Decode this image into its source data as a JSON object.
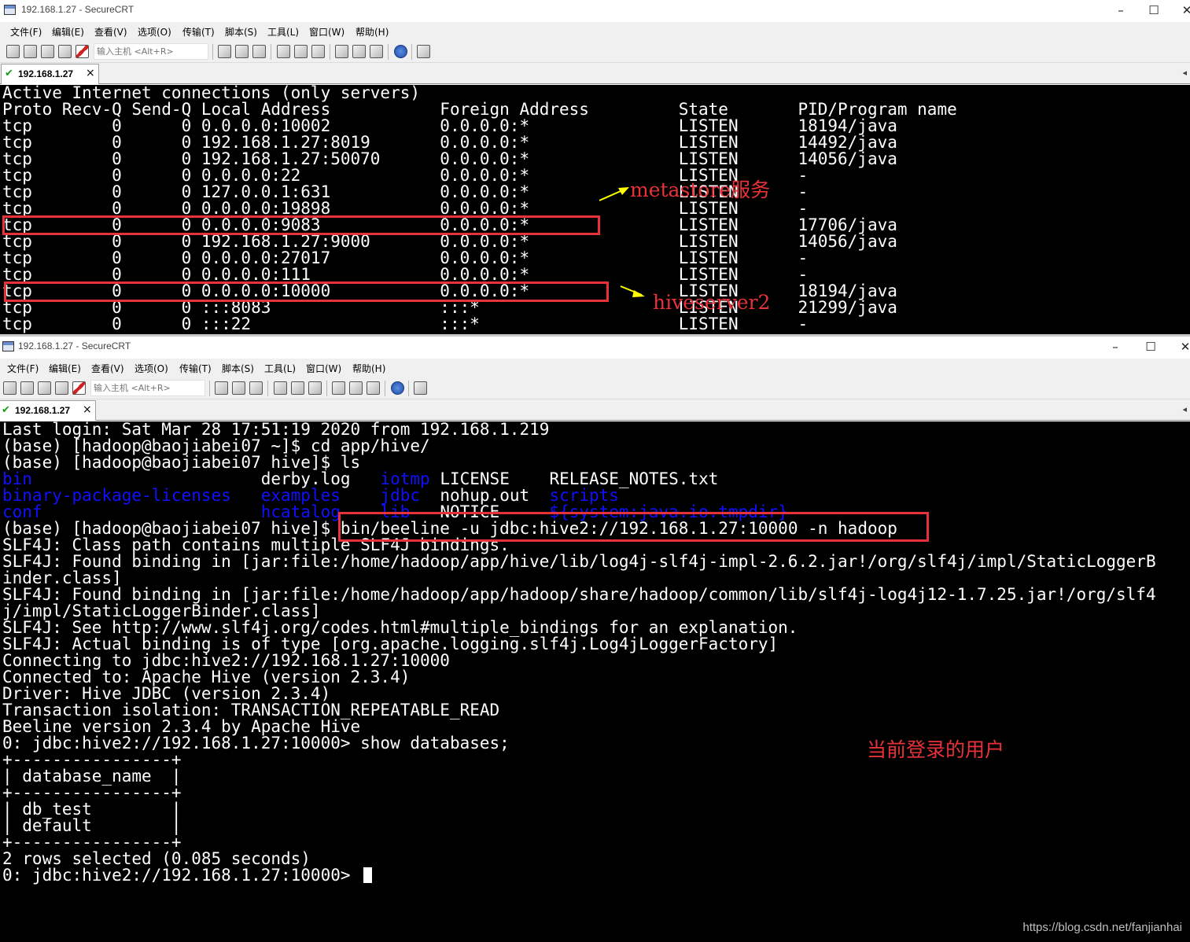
{
  "window1": {
    "title": "192.168.1.27 - SecureCRT",
    "menu": [
      "文件(F)",
      "编辑(E)",
      "查看(V)",
      "选项(O)",
      "传输(T)",
      "脚本(S)",
      "工具(L)",
      "窗口(W)",
      "帮助(H)"
    ],
    "quick_connect_placeholder": "输入主机 <Alt+R>",
    "tab_label": "192.168.1.27",
    "terminal_lines": [
      "Active Internet connections (only servers)",
      "Proto Recv-Q Send-Q Local Address           Foreign Address         State       PID/Program name",
      "tcp        0      0 0.0.0.0:10002           0.0.0.0:*               LISTEN      18194/java",
      "tcp        0      0 192.168.1.27:8019       0.0.0.0:*               LISTEN      14492/java",
      "tcp        0      0 192.168.1.27:50070      0.0.0.0:*               LISTEN      14056/java",
      "tcp        0      0 0.0.0.0:22              0.0.0.0:*               LISTEN      -",
      "tcp        0      0 127.0.0.1:631           0.0.0.0:*               LISTEN      -",
      "tcp        0      0 0.0.0.0:19898           0.0.0.0:*               LISTEN      -",
      "tcp        0      0 0.0.0.0:9083            0.0.0.0:*               LISTEN      17706/java",
      "tcp        0      0 192.168.1.27:9000       0.0.0.0:*               LISTEN      14056/java",
      "tcp        0      0 0.0.0.0:27017           0.0.0.0:*               LISTEN      -",
      "tcp        0      0 0.0.0.0:111             0.0.0.0:*               LISTEN      -",
      "tcp        0      0 0.0.0.0:10000           0.0.0.0:*               LISTEN      18194/java",
      "tcp        0      0 :::8083                 :::*                    LISTEN      21299/java",
      "tcp        0      0 :::22                   :::*                    LISTEN      -"
    ],
    "annotation_metastore": "metastore服务",
    "annotation_hiveserver2": "hiveserver2"
  },
  "window2": {
    "title": "192.168.1.27 - SecureCRT",
    "menu": [
      "文件(F)",
      "编辑(E)",
      "查看(V)",
      "选项(O)",
      "传输(T)",
      "脚本(S)",
      "工具(L)",
      "窗口(W)",
      "帮助(H)"
    ],
    "quick_connect_placeholder": "输入主机 <Alt+R>",
    "tab_label": "192.168.1.27",
    "terminal": {
      "line_login": "Last login: Sat Mar 28 17:51:19 2020 from 192.168.1.219",
      "line_cd": "(base) [hadoop@baojiabei07 ~]$ cd app/hive/",
      "line_ls": "(base) [hadoop@baojiabei07 hive]$ ls",
      "ls_rows": [
        [
          {
            "t": "bin",
            "blue": true
          },
          {
            "t": "derby.log",
            "blue": false
          },
          {
            "t": "iotmp",
            "blue": true
          },
          {
            "t": "LICENSE",
            "blue": false
          },
          {
            "t": "RELEASE_NOTES.txt",
            "blue": false
          }
        ],
        [
          {
            "t": "binary-package-licenses",
            "blue": true
          },
          {
            "t": "examples",
            "blue": true
          },
          {
            "t": "jdbc",
            "blue": true
          },
          {
            "t": "nohup.out",
            "blue": false
          },
          {
            "t": "scripts",
            "blue": true
          }
        ],
        [
          {
            "t": "conf",
            "blue": true
          },
          {
            "t": "hcatalog",
            "blue": true
          },
          {
            "t": "lib",
            "blue": true
          },
          {
            "t": "NOTICE",
            "blue": false
          },
          {
            "t": "${system:java.io.tmpdir}",
            "blue": true
          }
        ]
      ],
      "prompt_beeline": "(base) [hadoop@baojiabei07 hive]$ ",
      "beeline_cmd": "bin/beeline -u jdbc:hive2://192.168.1.27:10000 -n hadoop",
      "output_lines": [
        "SLF4J: Class path contains multiple SLF4J bindings.",
        "SLF4J: Found binding in [jar:file:/home/hadoop/app/hive/lib/log4j-slf4j-impl-2.6.2.jar!/org/slf4j/impl/StaticLoggerB",
        "inder.class]",
        "SLF4J: Found binding in [jar:file:/home/hadoop/app/hadoop/share/hadoop/common/lib/slf4j-log4j12-1.7.25.jar!/org/slf4",
        "j/impl/StaticLoggerBinder.class]",
        "SLF4J: See http://www.slf4j.org/codes.html#multiple_bindings for an explanation.",
        "SLF4J: Actual binding is of type [org.apache.logging.slf4j.Log4jLoggerFactory]",
        "Connecting to jdbc:hive2://192.168.1.27:10000",
        "Connected to: Apache Hive (version 2.3.4)",
        "Driver: Hive JDBC (version 2.3.4)",
        "Transaction isolation: TRANSACTION_REPEATABLE_READ",
        "Beeline version 2.3.4 by Apache Hive",
        "0: jdbc:hive2://192.168.1.27:10000> show databases;",
        "+----------------+",
        "| database_name  |",
        "+----------------+",
        "| db_test        |",
        "| default        |",
        "+----------------+",
        "2 rows selected (0.085 seconds)"
      ],
      "final_prompt": "0: jdbc:hive2://192.168.1.27:10000> "
    },
    "annotation_user": "当前登录的用户"
  },
  "watermark": "https://blog.csdn.net/fanjianhai",
  "colors": {
    "annotation_red": "#e8323a",
    "arrow_yellow": "#ffff00",
    "dir_blue": "#1010ff",
    "terminal_bg": "#000000",
    "terminal_fg": "#ffffff"
  }
}
